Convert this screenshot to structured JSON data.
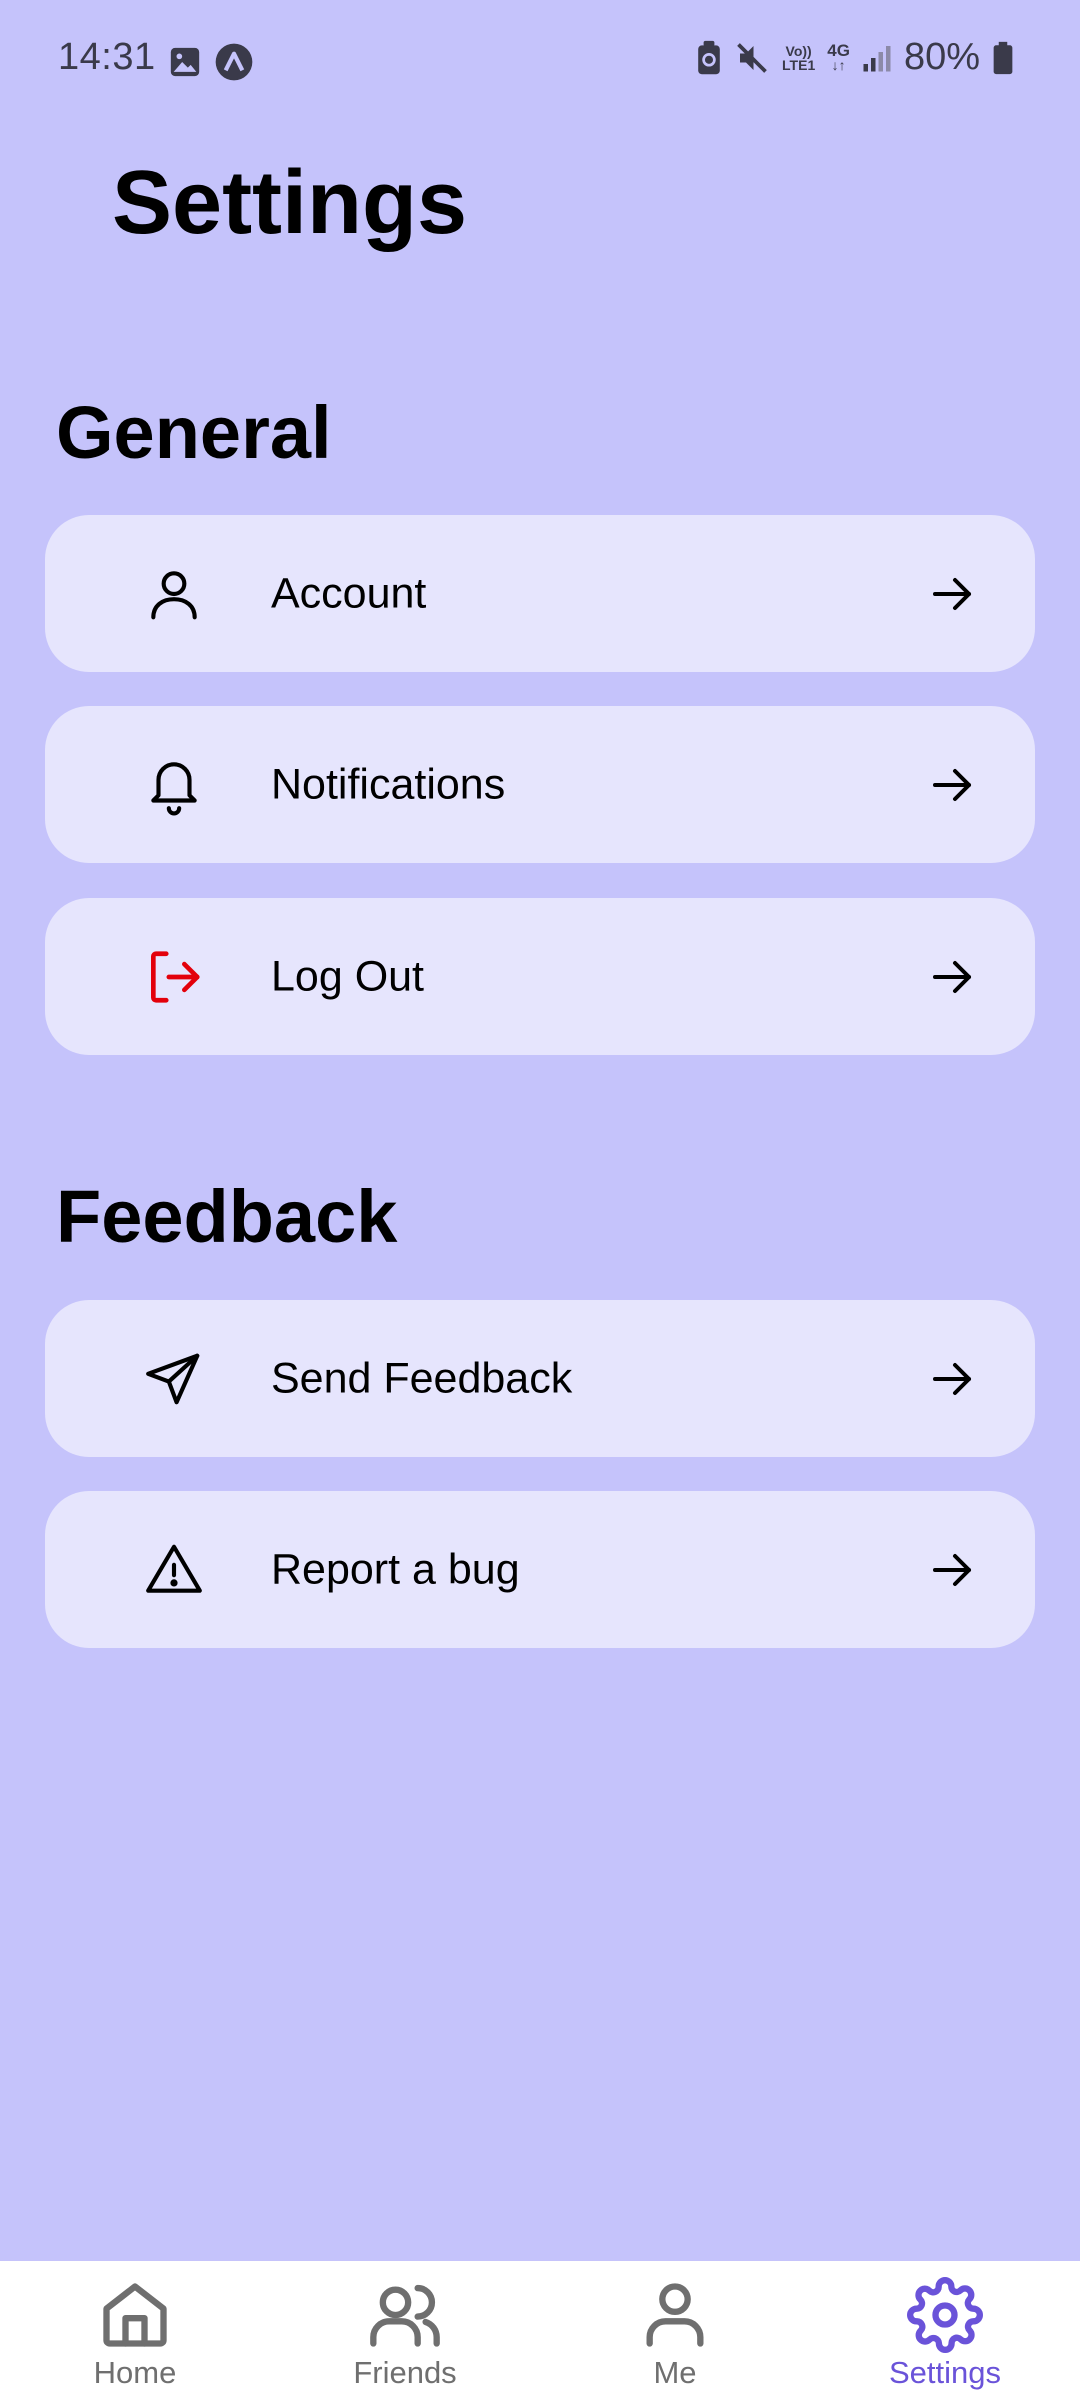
{
  "status_bar": {
    "time": "14:31",
    "volte_label_top": "Vo))",
    "volte_label_bottom": "LTE1",
    "network_label": "4G",
    "battery": "80%"
  },
  "page": {
    "title": "Settings"
  },
  "sections": [
    {
      "heading": "General",
      "items": [
        {
          "label": "Account",
          "icon": "user-icon"
        },
        {
          "label": "Notifications",
          "icon": "bell-icon"
        },
        {
          "label": "Log Out",
          "icon": "logout-icon",
          "icon_color": "#e3000b"
        }
      ]
    },
    {
      "heading": "Feedback",
      "items": [
        {
          "label": "Send Feedback",
          "icon": "send-icon"
        },
        {
          "label": "Report a bug",
          "icon": "warning-icon"
        }
      ]
    }
  ],
  "bottom_nav": {
    "items": [
      {
        "label": "Home",
        "icon": "home-icon",
        "active": false
      },
      {
        "label": "Friends",
        "icon": "friends-icon",
        "active": false
      },
      {
        "label": "Me",
        "icon": "user-icon",
        "active": false
      },
      {
        "label": "Settings",
        "icon": "gear-icon",
        "active": true
      }
    ]
  },
  "colors": {
    "background": "#c5c3fb",
    "card": "#e6e5fd",
    "accent": "#6a53d9",
    "logout": "#e3000b",
    "nav_inactive": "#6f6f6f"
  }
}
